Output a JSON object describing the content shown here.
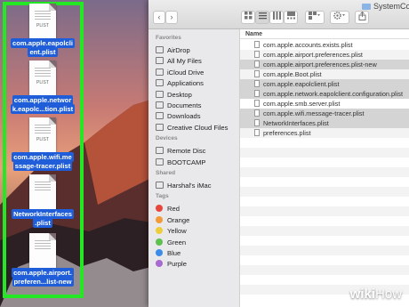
{
  "desktop": {
    "files": [
      {
        "label": "com.apple.eapolclient.plist",
        "lines": [
          "com.apple.eapolcli",
          "ent.plist"
        ],
        "icon_text": "PLIST"
      },
      {
        "label": "com.apple.network.eapolc...tion.plist",
        "lines": [
          "com.apple.networ",
          "k.eapolc...tion.plist"
        ],
        "icon_text": "PLIST"
      },
      {
        "label": "com.apple.wifi.message-tracer.plist",
        "lines": [
          "com.apple.wifi.me",
          "ssage-tracer.plist"
        ],
        "icon_text": "PLIST"
      },
      {
        "label": "NetworkInterfaces.plist",
        "lines": [
          "NetworkInterfaces",
          ".plist"
        ],
        "icon_text": ""
      },
      {
        "label": "com.apple.airport.preferen...list-new",
        "lines": [
          "com.apple.airport.",
          "preferen...list-new"
        ],
        "icon_text": ""
      }
    ]
  },
  "finder": {
    "title": "SystemCo",
    "toolbar": {
      "back": "‹",
      "forward": "›"
    },
    "sidebar": {
      "favorites_header": "Favorites",
      "favorites": [
        {
          "label": "AirDrop",
          "icon": "airdrop-icon"
        },
        {
          "label": "All My Files",
          "icon": "all-files-icon"
        },
        {
          "label": "iCloud Drive",
          "icon": "cloud-icon"
        },
        {
          "label": "Applications",
          "icon": "applications-icon"
        },
        {
          "label": "Desktop",
          "icon": "desktop-icon"
        },
        {
          "label": "Documents",
          "icon": "documents-icon"
        },
        {
          "label": "Downloads",
          "icon": "downloads-icon"
        },
        {
          "label": "Creative Cloud Files",
          "icon": "creative-cloud-icon"
        }
      ],
      "devices_header": "Devices",
      "devices": [
        {
          "label": "Remote Disc",
          "icon": "disc-icon"
        },
        {
          "label": "BOOTCAMP",
          "icon": "drive-icon"
        }
      ],
      "shared_header": "Shared",
      "shared": [
        {
          "label": "Harshal's iMac",
          "icon": "imac-icon"
        }
      ],
      "tags_header": "Tags",
      "tags": [
        {
          "label": "Red",
          "color": "#e8453c"
        },
        {
          "label": "Orange",
          "color": "#f29a38"
        },
        {
          "label": "Yellow",
          "color": "#efcc3a"
        },
        {
          "label": "Green",
          "color": "#5dc04f"
        },
        {
          "label": "Blue",
          "color": "#3c8ce8"
        },
        {
          "label": "Purple",
          "color": "#a869d0"
        }
      ]
    },
    "list": {
      "column_name": "Name",
      "rows": [
        {
          "name": "com.apple.accounts.exists.plist",
          "selected": false
        },
        {
          "name": "com.apple.airport.preferences.plist",
          "selected": false
        },
        {
          "name": "com.apple.airport.preferences.plist-new",
          "selected": true
        },
        {
          "name": "com.apple.Boot.plist",
          "selected": false
        },
        {
          "name": "com.apple.eapolclient.plist",
          "selected": true
        },
        {
          "name": "com.apple.network.eapolclient.configuration.plist",
          "selected": true
        },
        {
          "name": "com.apple.smb.server.plist",
          "selected": false
        },
        {
          "name": "com.apple.wifi.message-tracer.plist",
          "selected": true
        },
        {
          "name": "NetworkInterfaces.plist",
          "selected": true
        },
        {
          "name": "preferences.plist",
          "selected": false
        }
      ]
    }
  },
  "watermark": {
    "wiki": "wiki",
    "how": "How"
  }
}
